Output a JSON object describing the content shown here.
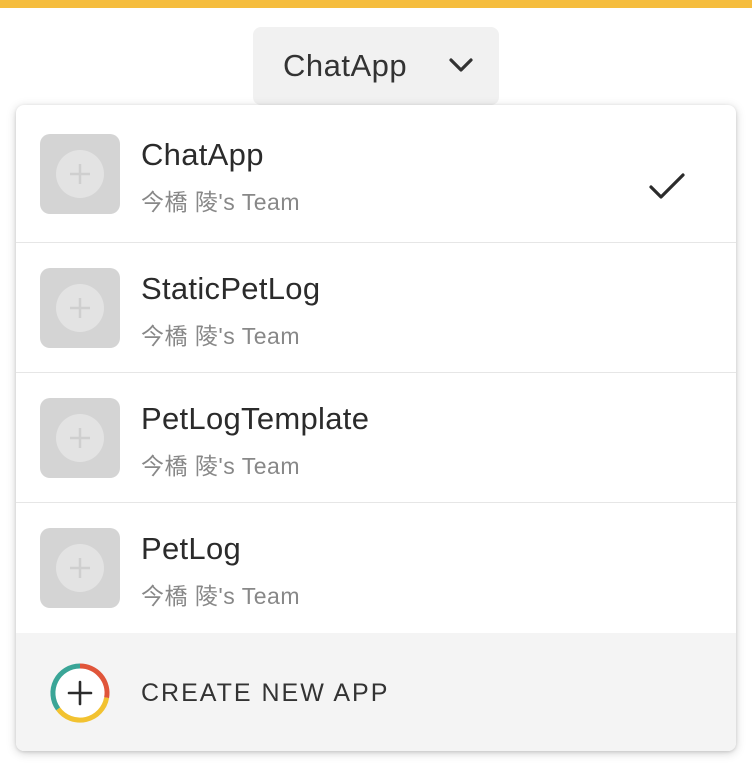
{
  "header": {
    "current_app": "ChatApp",
    "chevron_icon": "chevron-down-icon",
    "accent_color": "#f5bd3e"
  },
  "app_list": {
    "items": [
      {
        "name": "ChatApp",
        "team": "今橋 陵's Team",
        "selected": true,
        "icon": "plus-icon"
      },
      {
        "name": "StaticPetLog",
        "team": "今橋 陵's Team",
        "selected": false,
        "icon": "plus-icon"
      },
      {
        "name": "PetLogTemplate",
        "team": "今橋 陵's Team",
        "selected": false,
        "icon": "plus-icon"
      },
      {
        "name": "PetLog",
        "team": "今橋 陵's Team",
        "selected": false,
        "icon": "plus-icon"
      }
    ],
    "selected_icon": "check-icon"
  },
  "create_new": {
    "label": "CREATE NEW APP",
    "icon": "create-app-plus-icon",
    "ring_colors": [
      "#e0553a",
      "#f2c230",
      "#3aa597"
    ]
  }
}
